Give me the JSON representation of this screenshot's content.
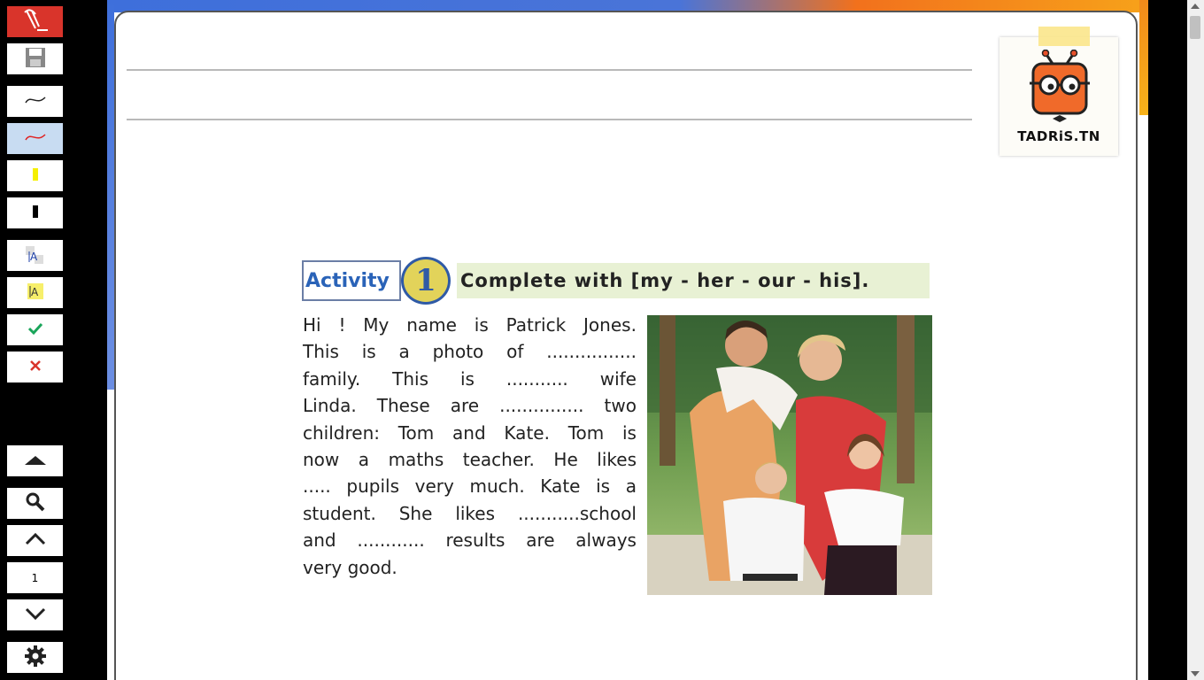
{
  "toolbar": {
    "tools": [
      {
        "name": "annotation-logo-button",
        "icon": "pen-logo-icon"
      },
      {
        "name": "save-button",
        "icon": "floppy-disk-icon"
      },
      {
        "name": "pen-black-button",
        "icon": "black-pen-line-icon"
      },
      {
        "name": "pen-red-button",
        "icon": "red-pen-line-icon"
      },
      {
        "name": "highlighter-yellow-button",
        "icon": "yellow-highlighter-icon"
      },
      {
        "name": "marker-black-button",
        "icon": "black-marker-icon"
      },
      {
        "name": "text-tool-button",
        "icon": "text-a-icon"
      },
      {
        "name": "text-highlight-button",
        "icon": "highlighted-text-a-icon"
      },
      {
        "name": "confirm-button",
        "icon": "check-icon"
      },
      {
        "name": "clear-button",
        "icon": "close-icon"
      }
    ],
    "nav": {
      "page_number": "1",
      "icons": [
        "scroll-top-icon",
        "search-icon",
        "chevron-up-icon",
        "chevron-down-icon",
        "gear-icon"
      ]
    },
    "colors": {
      "accent_red": "#d9342b",
      "active_bg": "#c8dcf2",
      "check": "#1aa55a",
      "close": "#d9342b"
    }
  },
  "logo": {
    "text": "TADRiS.TN"
  },
  "activity": {
    "label": "Activity",
    "number": "1",
    "instruction": "Complete with [my - her - our - his]."
  },
  "passage": {
    "lines": [
      "Hi ! My name is Patrick Jones.",
      "This is a photo of ................",
      "family. This is ........... wife",
      "Linda. These are ............... two",
      "children: Tom and Kate. Tom is",
      "now a maths teacher. He likes",
      "..... pupils very much. Kate is a",
      "student. She likes ...........school",
      "and ............ results are always",
      "very good."
    ]
  },
  "photo": {
    "subject": "family-photo"
  }
}
